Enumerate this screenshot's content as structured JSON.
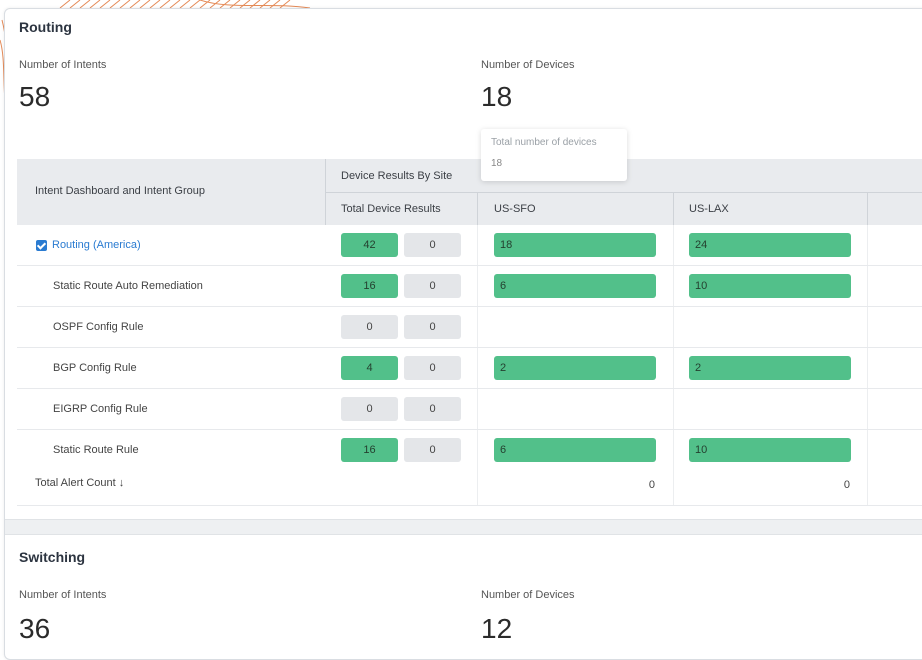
{
  "routing": {
    "title": "Routing",
    "intents_label": "Number of Intents",
    "intents_value": "58",
    "devices_label": "Number of Devices",
    "devices_value": "18",
    "tooltip": {
      "label": "Total number of devices",
      "value": "18"
    },
    "table": {
      "col_intent": "Intent Dashboard and Intent Group",
      "col_site_group": "Device Results By Site",
      "col_total": "Total Device Results",
      "col_site1": "US-SFO",
      "col_site2": "US-LAX",
      "rows": [
        {
          "label": "Routing (America)",
          "a": "42",
          "b": "0",
          "sfo": "18",
          "lax": "24"
        },
        {
          "label": "Static Route Auto Remediation",
          "a": "16",
          "b": "0",
          "sfo": "6",
          "lax": "10"
        },
        {
          "label": "OSPF Config Rule",
          "a": "0",
          "b": "0",
          "sfo": "",
          "lax": ""
        },
        {
          "label": "BGP Config Rule",
          "a": "4",
          "b": "0",
          "sfo": "2",
          "lax": "2"
        },
        {
          "label": "EIGRP Config Rule",
          "a": "0",
          "b": "0",
          "sfo": "",
          "lax": ""
        },
        {
          "label": "Static Route Rule",
          "a": "16",
          "b": "0",
          "sfo": "6",
          "lax": "10"
        }
      ],
      "total_label": "Total Alert Count ↓",
      "total_sfo": "0",
      "total_lax": "0"
    }
  },
  "switching": {
    "title": "Switching",
    "intents_label": "Number of Intents",
    "intents_value": "36",
    "devices_label": "Number of Devices",
    "devices_value": "12"
  },
  "colors": {
    "green": "#52c08a",
    "accent": "#2a7bd1",
    "deco": "#e0763a"
  }
}
